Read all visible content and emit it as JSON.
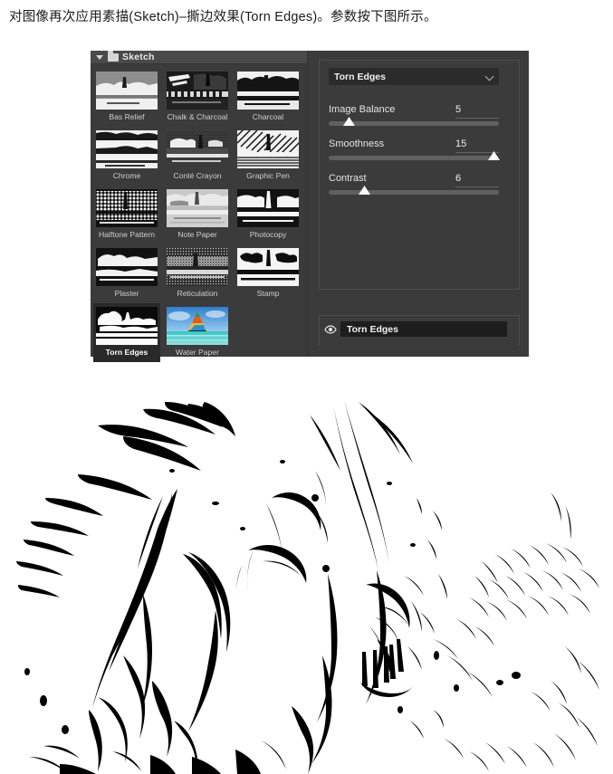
{
  "caption": {
    "text": "对图像再次应用素描(Sketch)–撕边效果(Torn Edges)。参数按下图所示。"
  },
  "gallery": {
    "group": {
      "title": "Sketch",
      "expanded_icon": "disclosure-triangle-down",
      "folder_icon": "folder-icon"
    },
    "filters": [
      {
        "label": "Bas Relief",
        "selected": false,
        "thumb": "grayscale-bas-relief"
      },
      {
        "label": "Chalk & Charcoal",
        "selected": false,
        "thumb": "grayscale-chalk-charcoal"
      },
      {
        "label": "Charcoal",
        "selected": false,
        "thumb": "grayscale-charcoal"
      },
      {
        "label": "Chrome",
        "selected": false,
        "thumb": "grayscale-chrome"
      },
      {
        "label": "Conté Crayon",
        "selected": false,
        "thumb": "grayscale-conte-crayon"
      },
      {
        "label": "Graphic Pen",
        "selected": false,
        "thumb": "grayscale-graphic-pen"
      },
      {
        "label": "Halftone Pattern",
        "selected": false,
        "thumb": "grayscale-halftone-pattern"
      },
      {
        "label": "Note Paper",
        "selected": false,
        "thumb": "grayscale-note-paper"
      },
      {
        "label": "Photocopy",
        "selected": false,
        "thumb": "grayscale-photocopy"
      },
      {
        "label": "Plaster",
        "selected": false,
        "thumb": "grayscale-plaster"
      },
      {
        "label": "Reticulation",
        "selected": false,
        "thumb": "grayscale-reticulation"
      },
      {
        "label": "Stamp",
        "selected": false,
        "thumb": "grayscale-stamp"
      },
      {
        "label": "Torn Edges",
        "selected": true,
        "thumb": "grayscale-torn-edges"
      },
      {
        "label": "Water Paper",
        "selected": false,
        "thumb": "color-water-paper"
      }
    ],
    "controls": {
      "filter_select": {
        "value": "Torn Edges",
        "chevron_icon": "chevron-down-icon"
      },
      "sliders": [
        {
          "name": "Image Balance",
          "value": "5",
          "percent": 12
        },
        {
          "name": "Smoothness",
          "value": "15",
          "percent": 97
        },
        {
          "name": "Contrast",
          "value": "6",
          "percent": 21
        }
      ]
    },
    "layers": [
      {
        "name": "Torn Edges",
        "visible": true,
        "eye_icon": "eye-icon"
      }
    ]
  },
  "artwork": {
    "caption": "Black and white torn-edges sketch of hands",
    "background": "#ffffff",
    "ink": "#000000"
  },
  "colors": {
    "panel_bg": "#3b3b3b",
    "panel_header": "#4a4a4a",
    "selected_cell": "#292929",
    "chip_bg": "#1d1d1d",
    "track": "#606060",
    "text": "#e4e4e4"
  }
}
